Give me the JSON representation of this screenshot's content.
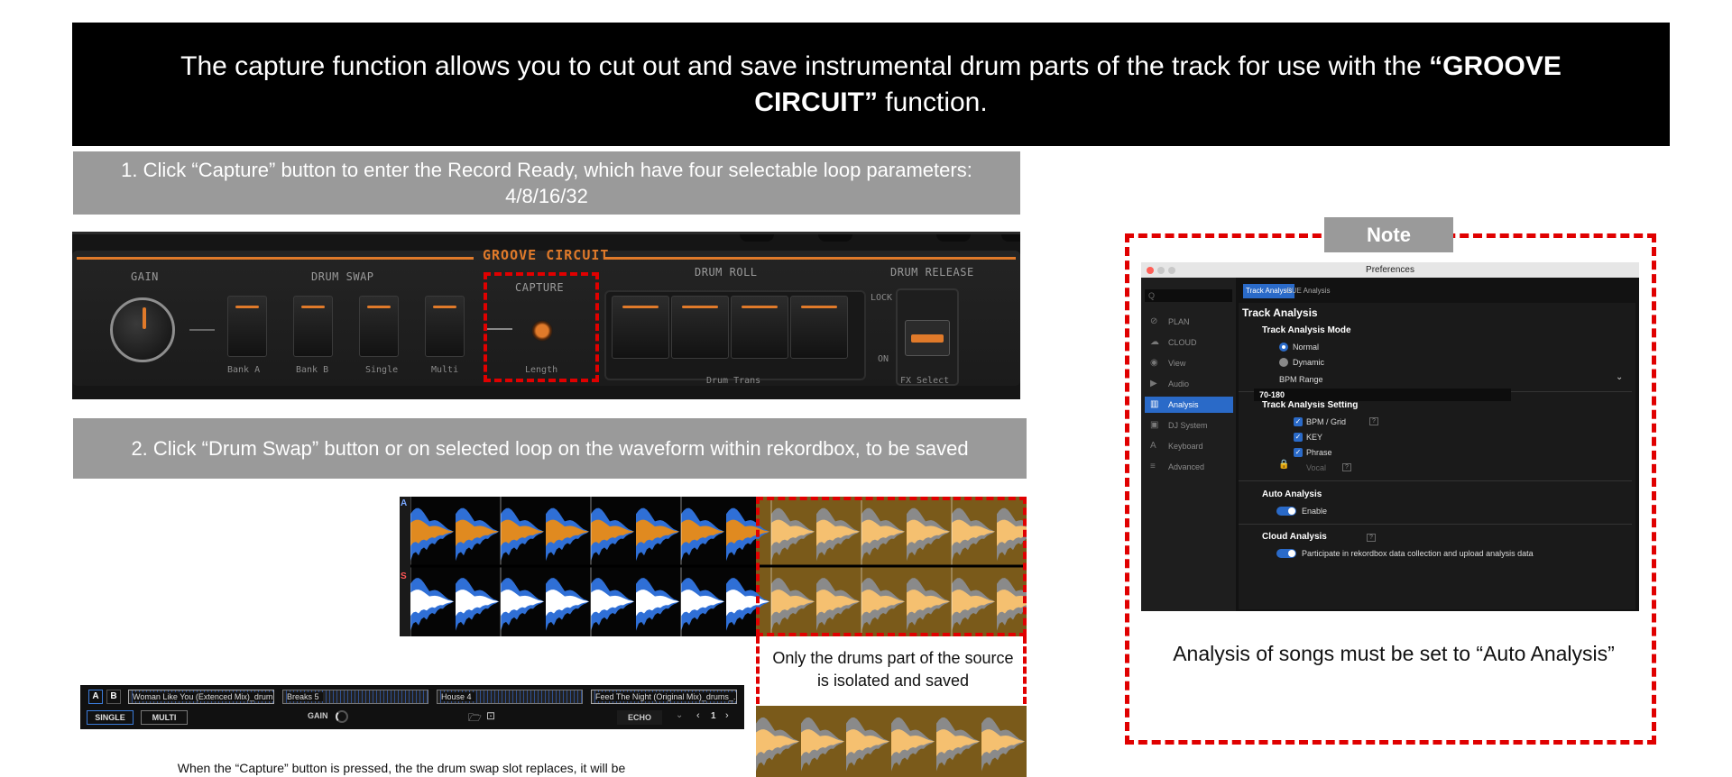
{
  "header": {
    "text_prefix": "The capture function allows you to cut out and save instrumental drum parts of the track for use with the ",
    "text_bold": "“GROOVE CIRCUIT”",
    "text_suffix": " function."
  },
  "step1": {
    "text": "1. Click “Capture” button to enter the Record Ready, which have four selectable loop parameters: 4/8/16/32"
  },
  "step2": {
    "text": "2. Click “Drum Swap” button or on selected loop on the waveform within rekordbox, to be saved"
  },
  "hardware": {
    "groove_circuit": "GROOVE CIRCUIT",
    "gain": "GAIN",
    "drum_swap": "DRUM SWAP",
    "capture": "CAPTURE",
    "drum_roll": "DRUM ROLL",
    "drum_release": "DRUM RELEASE",
    "bank_a": "Bank A",
    "bank_b": "Bank B",
    "single": "Single",
    "multi": "Multi",
    "length": "Length",
    "drum_trans": "Drum Trans",
    "lock": "LOCK",
    "on": "ON",
    "fx_select": "FX Select",
    "accent_color": "#e07a2a",
    "highlight_color": "#e00000"
  },
  "waveform": {
    "marker_top": "A",
    "marker_bottom": "S"
  },
  "isolated_caption": "Only the drums part of the source is isolated and saved",
  "deck": {
    "a": "A",
    "b": "B",
    "slots": [
      "Woman Like You (Extenced Mix)_drum...",
      "Breaks 5",
      "House 4",
      "Feed The Night (Original Mix)_drums_..."
    ],
    "single": "SINGLE",
    "multi": "MULTI",
    "gain": "GAIN",
    "echo": "ECHO",
    "page": "1"
  },
  "bottom_caption": "When the “Capture” button is pressed, the the drum swap slot replaces, it will be",
  "note": {
    "tab": "Note",
    "caption": "Analysis of songs must be set to “Auto Analysis”"
  },
  "prefs": {
    "window_title": "Preferences",
    "search_placeholder": "Q",
    "nav": [
      "PLAN",
      "CLOUD",
      "View",
      "Audio",
      "Analysis",
      "DJ System",
      "Keyboard",
      "Advanced"
    ],
    "nav_icons": [
      "plan-icon",
      "cloud-icon",
      "view-icon",
      "audio-icon",
      "analysis-icon",
      "dj-system-icon",
      "keyboard-icon",
      "advanced-icon"
    ],
    "active_nav": "Analysis",
    "tabs": [
      "Track Analysis",
      "CUE Analysis"
    ],
    "section_title": "Track Analysis",
    "mode_title": "Track Analysis Mode",
    "mode_normal": "Normal",
    "mode_dynamic": "Dynamic",
    "bpm_range_label": "BPM Range",
    "bpm_range_value": "70-180",
    "setting_title": "Track Analysis Setting",
    "setting_bpm": "BPM / Grid",
    "setting_key": "KEY",
    "setting_phrase": "Phrase",
    "setting_vocal": "Vocal",
    "auto_title": "Auto Analysis",
    "auto_enable": "Enable",
    "cloud_title": "Cloud Analysis",
    "cloud_participate": "Participate in rekordbox data collection and upload analysis data",
    "accent": "#2a6ac8"
  }
}
